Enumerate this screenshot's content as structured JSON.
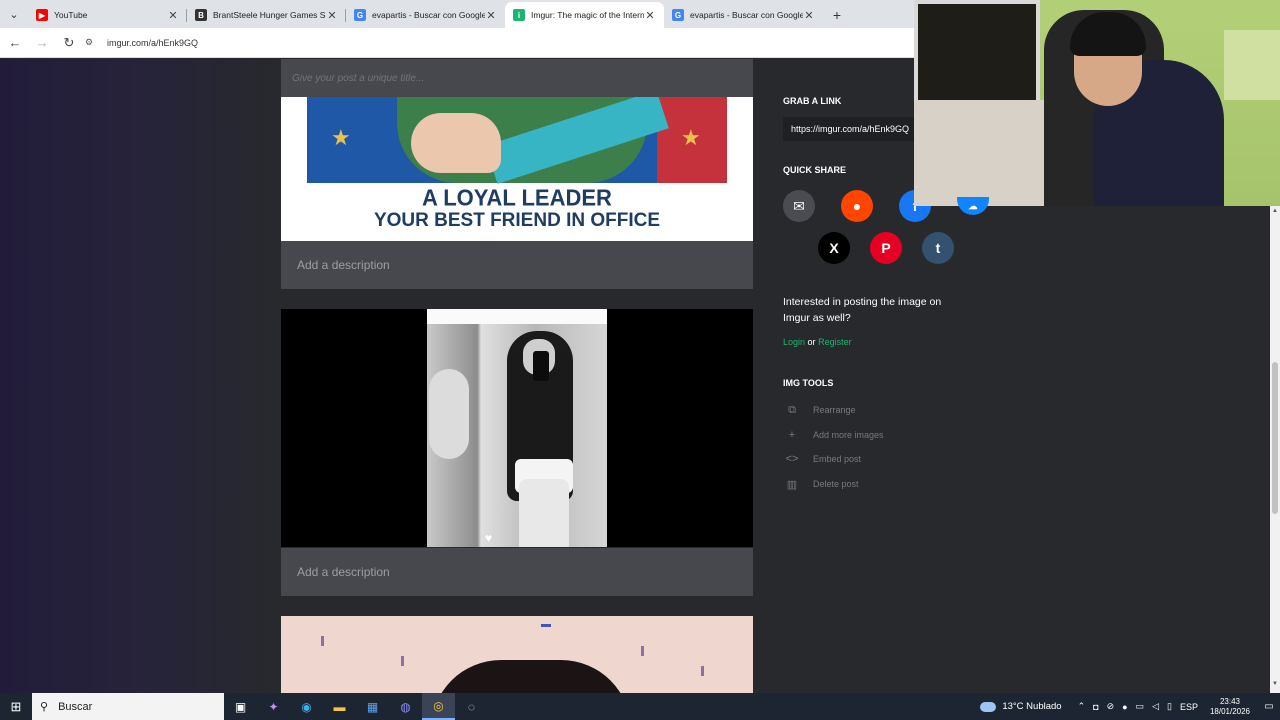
{
  "browser": {
    "tabs": [
      {
        "title": "YouTube",
        "favicon": "youtube-icon",
        "color": "#ff0000",
        "glyph": "▶"
      },
      {
        "title": "BrantSteele Hunger Games Sim",
        "favicon": "brantsteele-icon",
        "color": "#333333",
        "glyph": "B"
      },
      {
        "title": "evapartis - Buscar con Google",
        "favicon": "google-icon",
        "color": "#4285f4",
        "glyph": "G"
      },
      {
        "title": "Imgur: The magic of the Interne",
        "favicon": "imgur-icon",
        "color": "#1bb76e",
        "glyph": "i",
        "active": true
      },
      {
        "title": "evapartis - Buscar con Google",
        "favicon": "google-icon",
        "color": "#4285f4",
        "glyph": "G"
      }
    ],
    "url": "imgur.com/a/hEnk9GQ"
  },
  "post": {
    "title_placeholder": "Give your post a unique title...",
    "image1": {
      "line1": "A LOYAL LEADER",
      "line2": "YOUR BEST FRIEND IN OFFICE"
    },
    "description_placeholder_1": "Add a description",
    "description_placeholder_2": "Add a description"
  },
  "sidebar": {
    "grab_link_heading": "GRAB A LINK",
    "link_value": "https://imgur.com/a/hEnk9GQ",
    "quick_share_heading": "QUICK SHARE",
    "share_buttons": [
      {
        "name": "email",
        "color": "#4a4c52",
        "glyph": "✉"
      },
      {
        "name": "reddit",
        "color": "#ff4500",
        "glyph": "●"
      },
      {
        "name": "facebook",
        "color": "#1877f2",
        "glyph": "f"
      },
      {
        "name": "bluesky",
        "color": "#1185fe",
        "glyph": "☁"
      },
      {
        "name": "x",
        "color": "#000000",
        "glyph": "X"
      },
      {
        "name": "pinterest",
        "color": "#e60023",
        "glyph": "P"
      },
      {
        "name": "tumblr",
        "color": "#34526f",
        "glyph": "t"
      }
    ],
    "interested_text": "Interested in posting the image on Imgur as well?",
    "login_label": "Login",
    "or_label": "or",
    "register_label": "Register",
    "tools_heading": "IMG TOOLS",
    "tools": [
      {
        "label": "Rearrange",
        "icon": "rearrange-icon",
        "glyph": "⧉"
      },
      {
        "label": "Add more images",
        "icon": "plus-icon",
        "glyph": "+"
      },
      {
        "label": "Embed post",
        "icon": "code-icon",
        "glyph": "<>"
      },
      {
        "label": "Delete post",
        "icon": "trash-icon",
        "glyph": "🗑"
      }
    ]
  },
  "taskbar": {
    "search_placeholder": "Buscar",
    "weather": "13°C  Nublado",
    "lang": "ESP",
    "time": "23:43",
    "date": "18/01/2026"
  }
}
